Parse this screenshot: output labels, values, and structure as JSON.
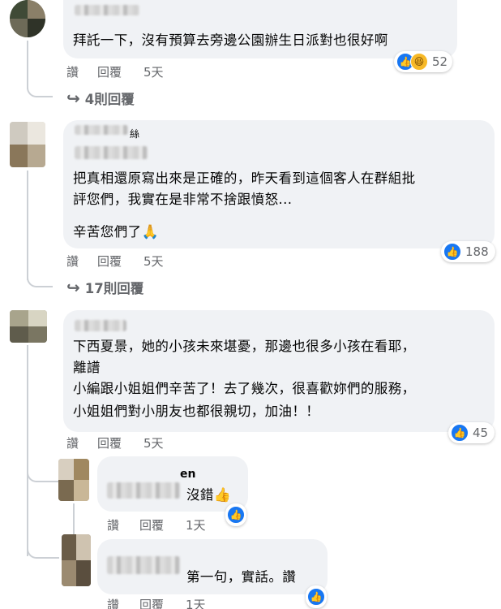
{
  "comments": [
    {
      "text_lines": [
        "拜託一下，沒有預算去旁邊公園辦生日派對也很好啊"
      ],
      "like_label": "讚",
      "reply_label": "回覆",
      "time": "5天",
      "reaction_count": "52",
      "reaction_icons": [
        "like-icon",
        "haha-icon"
      ],
      "replies_link": "4則回覆"
    },
    {
      "name_fragment": "絲",
      "text_lines": [
        "把真相還原寫出來是正確的，昨天看到這個客人在群組批",
        "評您們，我實在是非常不捨跟憤怒..."
      ],
      "text_line_extra": "辛苦您們了",
      "text_line_extra_emoji": "🙏",
      "like_label": "讚",
      "reply_label": "回覆",
      "time": "5天",
      "reaction_count": "188",
      "reaction_icons": [
        "like-icon"
      ],
      "replies_link": "17則回覆"
    },
    {
      "text_lines": [
        "下西夏景，她的小孩未來堪憂，那邊也很多小孩在看耶，",
        "離譜",
        "小編跟小姐姐們辛苦了！去了幾次，很喜歡妳們的服務，",
        "小姐姐們對小朋友也都很親切，加油！！"
      ],
      "like_label": "讚",
      "reply_label": "回覆",
      "time": "5天",
      "reaction_count": "45",
      "reaction_icons": [
        "like-icon"
      ]
    }
  ],
  "replies": [
    {
      "name_fragment": "en",
      "text": "沒錯",
      "text_emoji": "👍",
      "like_label": "讚",
      "reply_label": "回覆",
      "time": "1天",
      "reaction_icons": [
        "like-icon"
      ]
    },
    {
      "text": "第一句，實話。讚",
      "like_label": "讚",
      "reply_label": "回覆",
      "time": "1天",
      "reaction_icons": [
        "like-icon"
      ]
    }
  ],
  "icons": {
    "reply_arrow": "↪",
    "like_glyph": "👍",
    "haha_glyph": "😆"
  },
  "colors": {
    "bubble": "#f0f2f5",
    "secondary_text": "#65676b",
    "like_blue": "#1877f2"
  }
}
